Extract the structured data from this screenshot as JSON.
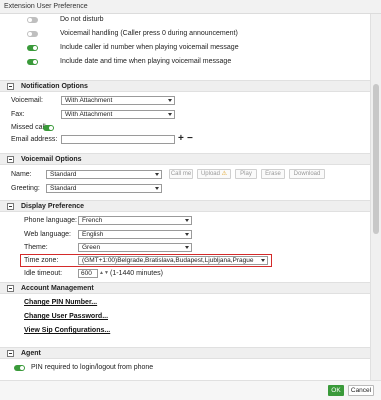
{
  "window": {
    "title": "Extension User Preference"
  },
  "top_options": [
    {
      "label": "Do not disturb",
      "state": "off"
    },
    {
      "label": "Voicemail handling (Caller press 0 during announcement)",
      "state": "off"
    },
    {
      "label": "Include caller id number when playing voicemail message",
      "state": "on"
    },
    {
      "label": "Include date and time when playing voicemail message",
      "state": "on"
    }
  ],
  "notification": {
    "title": "Notification Options",
    "voicemail_label": "Voicemail:",
    "voicemail_value": "With Attachment",
    "fax_label": "Fax:",
    "fax_value": "With Attachment",
    "missed_call_label": "Missed call",
    "missed_call_state": "on",
    "email_label": "Email address:",
    "email_value": "",
    "add_symbol": "+",
    "remove_symbol": "−"
  },
  "voicemail": {
    "title": "Voicemail Options",
    "name_label": "Name:",
    "name_value": "Standard",
    "greeting_label": "Greeting:",
    "greeting_value": "Standard",
    "buttons": {
      "call_me": "Call me",
      "upload": "Upload",
      "play": "Play",
      "erase": "Erase",
      "download": "Download"
    }
  },
  "display": {
    "title": "Display Preference",
    "phone_language_label": "Phone language:",
    "phone_language_value": "French",
    "web_language_label": "Web language:",
    "web_language_value": "English",
    "theme_label": "Theme:",
    "theme_value": "Green",
    "timezone_label": "Time zone:",
    "timezone_value": "(GMT+1:00)Belgrade,Bratislava,Budapest,Ljubljana,Prague",
    "idle_label": "Idle timeout:",
    "idle_value": "600",
    "idle_hint": "(1-1440 minutes)"
  },
  "account": {
    "title": "Account Management",
    "links": [
      "Change PIN Number...",
      "Change User Password...",
      "View Sip Configurations..."
    ]
  },
  "agent": {
    "title": "Agent",
    "pin_label": "PIN required to login/logout from phone",
    "pin_state": "on"
  },
  "footer": {
    "ok_label": "OK",
    "cancel_label": "Cancel"
  },
  "colors": {
    "accent_green": "#3a9a3a",
    "highlight_red": "#d42a2a"
  }
}
